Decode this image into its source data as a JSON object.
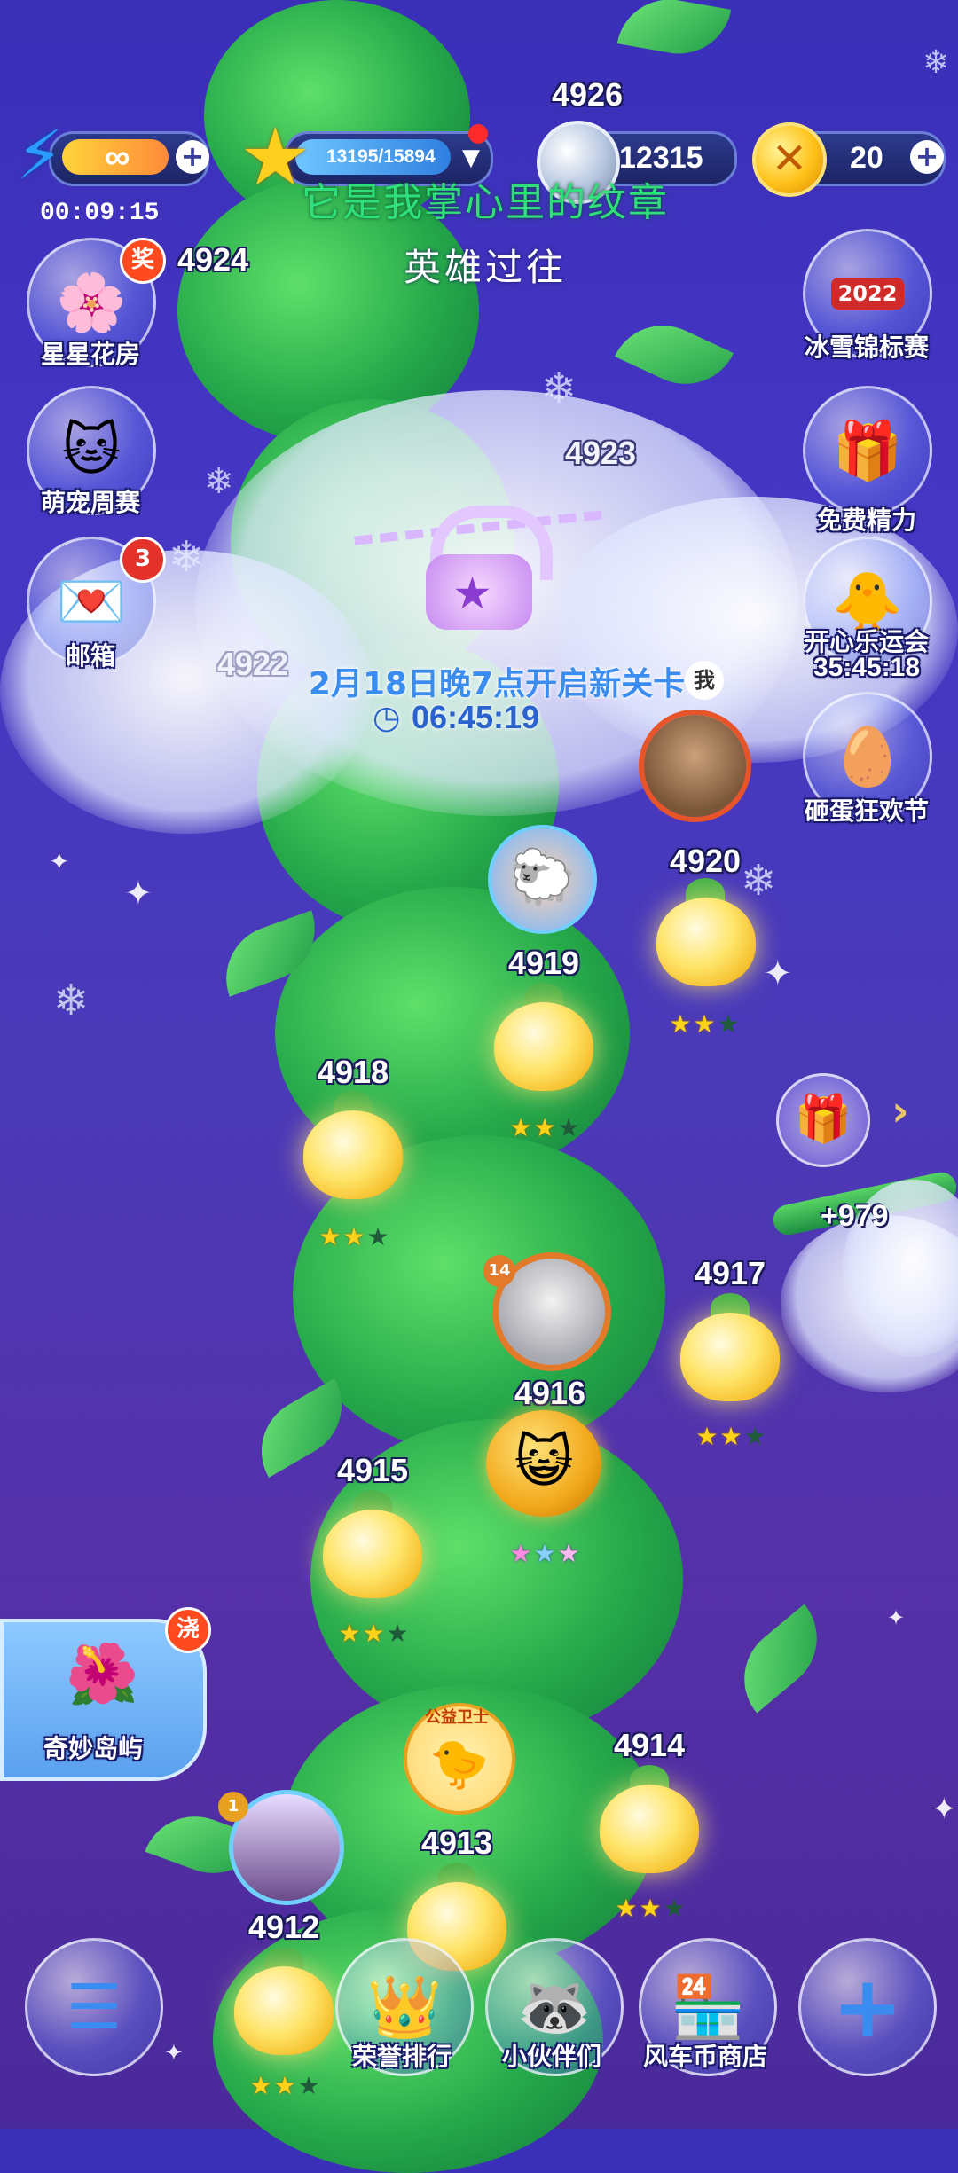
{
  "overlay": {
    "lyric_line1": "它是我掌心里的纹章",
    "lyric_line2": "英雄过往"
  },
  "topbar": {
    "energy_value": "∞",
    "energy_timer": "00:09:15",
    "stars_progress": "13195/15894",
    "coins_value": "12315",
    "gold_value": "20",
    "plus": "+"
  },
  "left_menu": [
    {
      "label": "星星花房",
      "badge": "奖",
      "icon": "flower-icon"
    },
    {
      "label": "萌宠周赛",
      "badge": "",
      "icon": "cat-icon"
    },
    {
      "label": "邮箱",
      "badge": "3",
      "icon": "mail-icon"
    }
  ],
  "right_menu": [
    {
      "label": "冰雪锦标赛",
      "icon": "trophy-2022-icon",
      "extra": "2022"
    },
    {
      "label": "免费精力",
      "icon": "gift-icon"
    },
    {
      "label": "开心乐运会",
      "timer": "35:45:18",
      "icon": "chick-icon"
    },
    {
      "label": "砸蛋狂欢节",
      "icon": "golden-egg-icon"
    }
  ],
  "unlock_notice": {
    "text": "2月18日晚7点开启新关卡",
    "timer": "06:45:19"
  },
  "me_tag": "我",
  "levels": {
    "l4926": "4926",
    "l4924": "4924",
    "l4923": "4923",
    "l4922": "4922",
    "l4920": "4920",
    "l4919": "4919",
    "l4918": "4918",
    "l4917": "4917",
    "l4916": "4916",
    "l4915": "4915",
    "l4914": "4914",
    "l4913": "4913",
    "l4912": "4912"
  },
  "branch_bonus": "+979",
  "friend_level_badge": "14",
  "friend_level_badge2": "1",
  "charity_badge": "公益卫士",
  "island": {
    "label": "奇妙岛屿",
    "badge": "浇"
  },
  "bottom_nav": [
    {
      "label": "",
      "icon": "menu-list-icon"
    },
    {
      "label": "荣誉排行",
      "icon": "crown-icon"
    },
    {
      "label": "小伙伴们",
      "icon": "raccoon-icon"
    },
    {
      "label": "风车币商店",
      "icon": "shop-icon"
    },
    {
      "label": "",
      "icon": "plus-icon"
    }
  ],
  "colors": {
    "background": "#4636c4",
    "stalk": "#25a84a",
    "star_on": "#ffd21a",
    "badge_red": "#e2322a"
  }
}
